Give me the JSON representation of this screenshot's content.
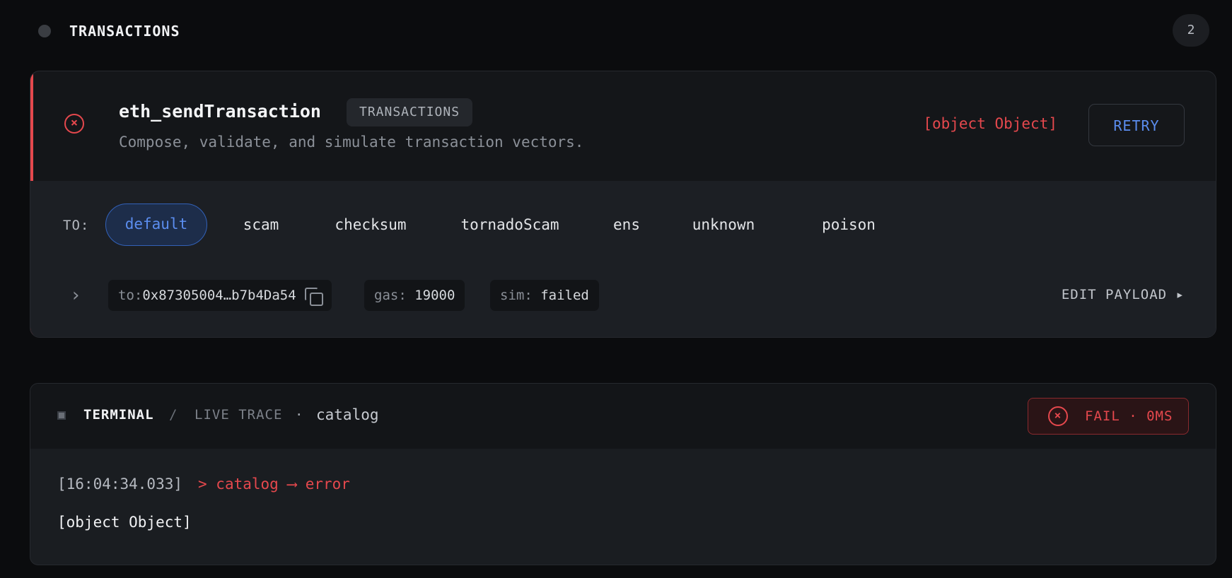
{
  "section": {
    "title": "TRANSACTIONS",
    "count": "2"
  },
  "card": {
    "method": "eth_sendTransaction",
    "tag": "TRANSACTIONS",
    "description": "Compose, validate, and simulate transaction vectors.",
    "error": "[object Object]",
    "retry_label": "RETRY",
    "status_icon": "x-circle-icon",
    "to_label": "TO:",
    "chips": [
      "default",
      "scam",
      "checksum",
      "tornadoScam",
      "ens",
      "unknown",
      "poison"
    ],
    "selected_chip": "default",
    "to_key": "to:",
    "to_value": "0x87305004…b7b4Da54",
    "gas_key": "gas:",
    "gas_value": "19000",
    "sim_key": "sim:",
    "sim_value": "failed",
    "edit_payload_label": "EDIT PAYLOAD ▸"
  },
  "terminal": {
    "title": "TERMINAL",
    "separator": "/",
    "subtitle": "LIVE TRACE",
    "dot": "·",
    "context": "catalog",
    "status": "FAIL · 0MS",
    "log_time": "[16:04:34.033]",
    "log_message": "> catalog ⟶ error",
    "log_body": "[object Object]"
  },
  "colors": {
    "error": "#e5484d",
    "accent": "#5b8def",
    "background": "#0b0c0e"
  }
}
